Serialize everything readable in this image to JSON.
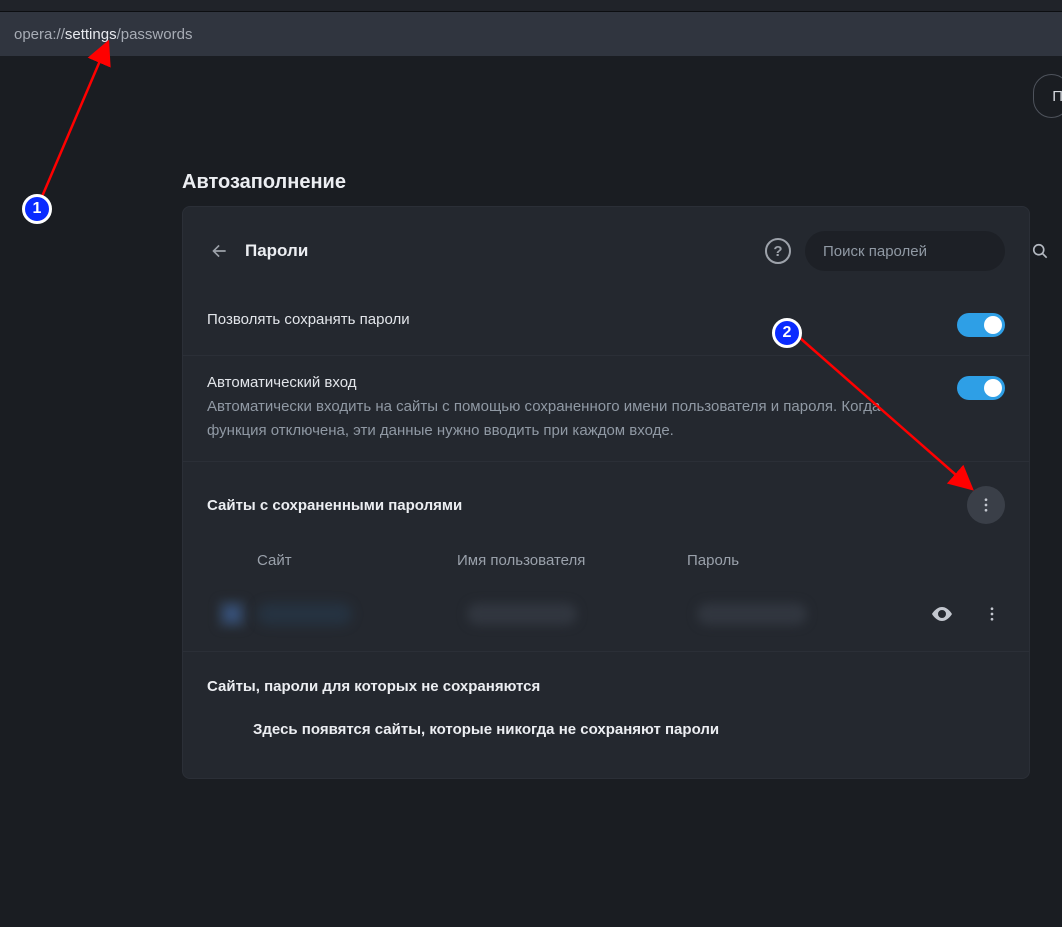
{
  "address": {
    "prefix": "opera://",
    "highlight": "settings",
    "suffix": "/passwords"
  },
  "top_button": {
    "label": "П"
  },
  "section_title": "Автозаполнение",
  "card": {
    "title": "Пароли",
    "search_placeholder": "Поиск паролей",
    "row_save": {
      "title": "Позволять сохранять пароли"
    },
    "row_autologin": {
      "title": "Автоматический вход",
      "desc": "Автоматически входить на сайты с помощью сохраненного имени пользователя и пароля. Когда функция отключена, эти данные нужно вводить при каждом входе."
    },
    "saved": {
      "title": "Сайты с сохраненными паролями",
      "col_site": "Сайт",
      "col_user": "Имя пользователя",
      "col_pass": "Пароль"
    },
    "never": {
      "title": "Сайты, пароли для которых не сохраняются",
      "empty": "Здесь появятся сайты, которые никогда не сохраняют пароли"
    }
  },
  "annotations": {
    "a1": "1",
    "a2": "2"
  }
}
